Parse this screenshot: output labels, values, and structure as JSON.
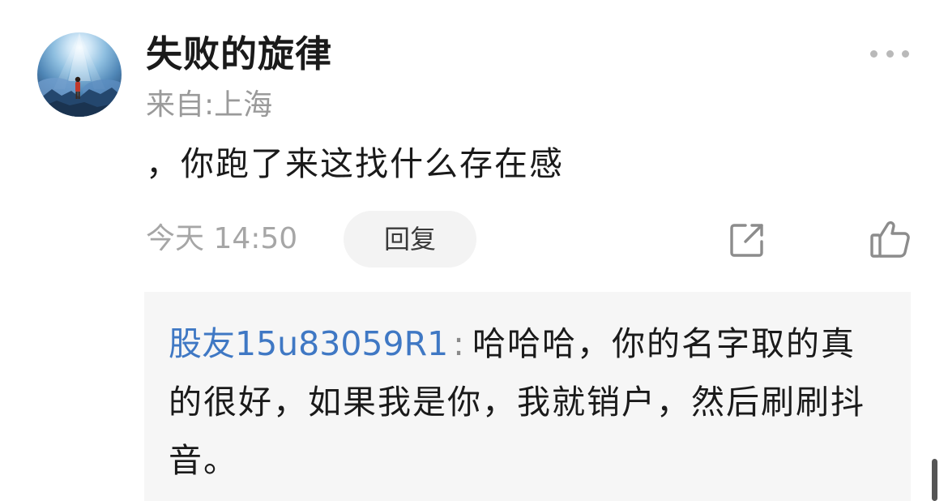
{
  "comment": {
    "username": "失败的旋律",
    "location": "来自:上海",
    "text": "，你跑了来这找什么存在感",
    "time": "今天 14:50",
    "reply_label": "回复"
  },
  "reply": {
    "author": "股友15u83059R1",
    "colon": ":",
    "text": "哈哈哈，你的名字取的真的很好，如果我是你，我就销户，然后刷刷抖音。"
  },
  "icons": {
    "more": "more-dots-icon",
    "share": "share-icon",
    "like": "thumbs-up-icon"
  },
  "colors": {
    "author_link": "#3f78c4",
    "secondary_text": "#9a9a9a",
    "reply_background": "#f6f6f6"
  }
}
